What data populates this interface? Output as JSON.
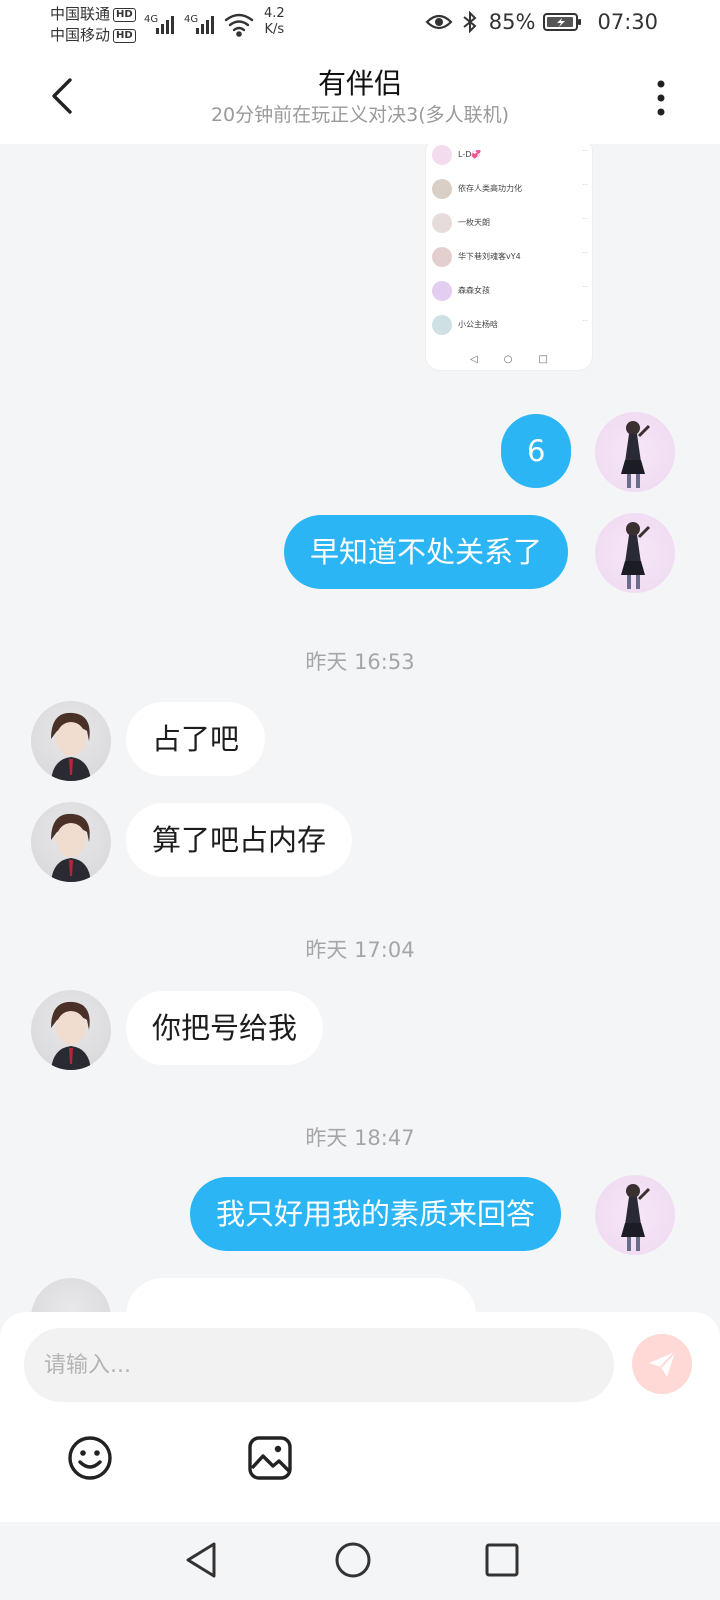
{
  "status_bar": {
    "carrier1": "中国联通",
    "carrier2": "中国移动",
    "hd_label": "HD",
    "network1": "4G",
    "network2": "4G",
    "speed_value": "4.2",
    "speed_unit": "K/s",
    "battery": "85%",
    "time": "07:30"
  },
  "header": {
    "title": "有伴侣",
    "subtitle": "20分钟前在玩正义对决3(多人联机)"
  },
  "shared_screenshot": {
    "rows": [
      {
        "name": "L-D💞"
      },
      {
        "name": "依存人类高功力化"
      },
      {
        "name": "一枚天朗"
      },
      {
        "name": "华下巷刘魂客vY4"
      },
      {
        "name": "森森女孩"
      },
      {
        "name": "小公主杨晗"
      }
    ]
  },
  "messages": [
    {
      "side": "me",
      "text": "6"
    },
    {
      "side": "me",
      "text": "早知道不处关系了"
    },
    {
      "type": "time",
      "text": "昨天 16:53"
    },
    {
      "side": "other",
      "text": "占了吧"
    },
    {
      "side": "other",
      "text": "算了吧占内存"
    },
    {
      "type": "time",
      "text": "昨天 17:04"
    },
    {
      "side": "other",
      "text": "你把号给我"
    },
    {
      "type": "time",
      "text": "昨天 18:47"
    },
    {
      "side": "me",
      "text": "我只好用我的素质来回答"
    }
  ],
  "input": {
    "placeholder": "请输入..."
  },
  "colors": {
    "my_bubble": "#2bb5f5",
    "send_button": "#ffd9d6"
  }
}
